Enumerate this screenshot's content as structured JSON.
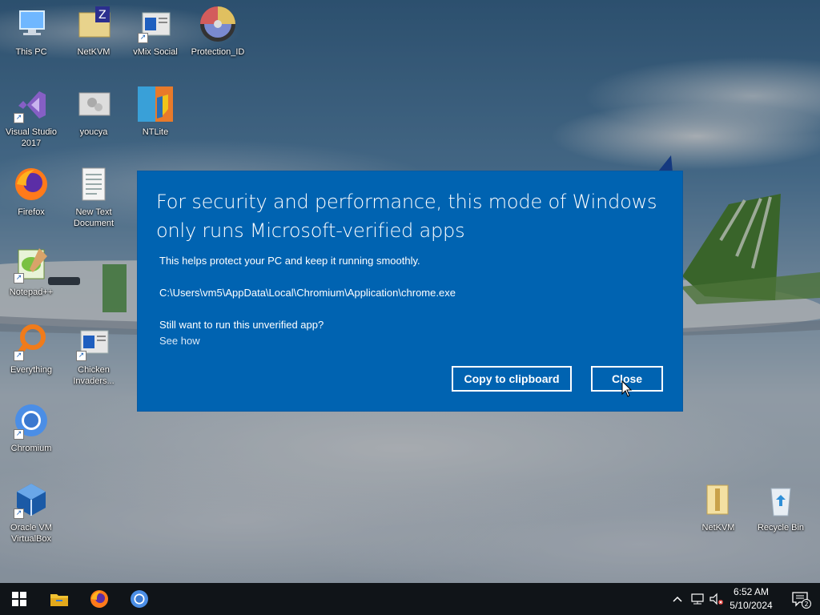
{
  "desktop": {
    "icons": [
      {
        "label": "This PC",
        "icon": "computer-icon"
      },
      {
        "label": "NetKVM",
        "icon": "zip-folder-icon"
      },
      {
        "label": "vMix Social",
        "icon": "app-window-icon"
      },
      {
        "label": "Protection_ID",
        "icon": "disc-icon"
      },
      {
        "label": "Visual Studio 2017",
        "icon": "visual-studio-icon"
      },
      {
        "label": "youcya",
        "icon": "gear-window-icon"
      },
      {
        "label": "NTLite",
        "icon": "ntlite-icon"
      },
      {
        "label": "Firefox",
        "icon": "firefox-icon"
      },
      {
        "label": "New Text Document",
        "icon": "text-document-icon"
      },
      {
        "label": "Notepad++",
        "icon": "notepadpp-icon"
      },
      {
        "label": "Everything",
        "icon": "search-magnifier-icon"
      },
      {
        "label": "Chicken Invaders...",
        "icon": "app-window-icon"
      },
      {
        "label": "Chromium",
        "icon": "chromium-icon"
      },
      {
        "label": "Oracle VM VirtualBox",
        "icon": "virtualbox-icon"
      },
      {
        "label": "NetKVM",
        "icon": "folder-icon"
      },
      {
        "label": "Recycle Bin",
        "icon": "recycle-bin-icon"
      }
    ]
  },
  "dialog": {
    "title": "For security and performance, this mode of Windows only runs Microsoft-verified apps",
    "subtitle": "This helps protect your PC and keep it running smoothly.",
    "path": "C:\\Users\\vm5\\AppData\\Local\\Chromium\\Application\\chrome.exe",
    "question": "Still want to run this unverified app?",
    "link": "See how",
    "copy_button": "Copy to clipboard",
    "close_button": "Close",
    "colors": {
      "background": "#0063b1",
      "text": "#ffffff"
    }
  },
  "taskbar": {
    "pinned": [
      "start-icon",
      "file-explorer-icon",
      "firefox-icon",
      "chromium-icon"
    ],
    "time": "6:52 AM",
    "date": "5/10/2024",
    "notification_count": "2"
  }
}
